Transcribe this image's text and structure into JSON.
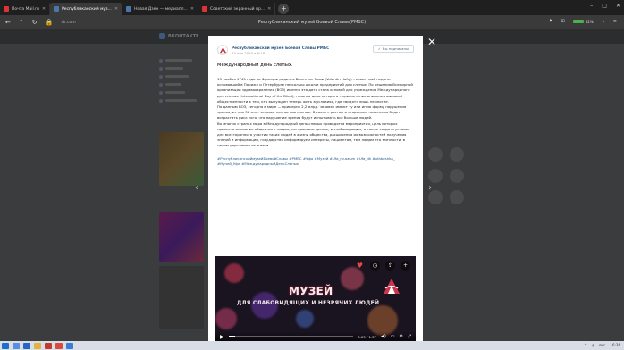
{
  "browser": {
    "tabs": [
      {
        "label": "Почта Mail.ru",
        "active": false
      },
      {
        "label": "Республиканский муз...",
        "active": true
      },
      {
        "label": "Новая Дзен — медиапл...",
        "active": false
      },
      {
        "label": "Советский экранный пр...",
        "active": false
      }
    ],
    "new_tab": "+",
    "window_title": "Республиканский музей Боевой Славы(РМБС)",
    "url": "vk.com",
    "battery": "52%",
    "controls": [
      "–",
      "□",
      "✕"
    ]
  },
  "vk": {
    "logo_text": "ВКОНТАКТЕ"
  },
  "post": {
    "group_name": "Республиканский музей Боевой Славы РМБС",
    "date": "13 ноя 2020 в 9:18",
    "subscribe_label": "Вы подписаны",
    "title": "Международный день слепых.",
    "paragraphs": [
      "13 ноября 1745 года во Франции родился Валентин Гаюи (Valentin Haüy) – известный педагог, основавший в Париже и Петербурге несколько школ и предприятий для слепых. По решению Всемирной организации здравоохранения (ВОЗ) именно эта дата стала основой для учреждения Международного дня слепых (International Day of the Blind), главная цель которого – привлечение внимания широкой общественности к тем, кто вынужден теперь жить в условиях, где «видят» лишь немногие.",
      "По данным ВОЗ, сегодня в мире — примерно 2,2 млрд. человек имеют ту или иную форму нарушения зрения, из них 36 млн. человек полностью слепые. В связи с ростом и старением населения будет возрастать риск того, что нарушение зрения будут испытывать всё больше людей.",
      "Во многих странах мира в Международный день слепых проводятся мероприятия, цель которых привлечь внимание общества к людям, потерявшим зрение, и слабовидящим, а также создать условия для всесторонного участия таких людей в жизни общества, расширения их возможностей получения знаний и информации, государство информируем интересы, пациентам, тем людям его занятости, в целом улучшения их жизни."
    ],
    "tags": "#РеспубликанскиймузейБоевойСлавы #РМБС #Уфа #Музей #Ufa_museum #Ufa_dk #ufabeshka_ #Музей_Уфа #МеждународныйДеньСлепых",
    "close_label": "✕",
    "prev_label": "‹",
    "next_label": "›"
  },
  "video": {
    "title": "МУЗЕЙ",
    "subtitle": "ДЛЯ СЛАБОВИДЯЩИХ И НЕЗРЯЧИХ ЛЮДЕЙ",
    "time": "0:05 / 1:37",
    "progress_fraction": 0.05,
    "icons": [
      "heart-icon",
      "clock-icon",
      "share-icon",
      "add-icon"
    ]
  },
  "taskbar": {
    "lang": "РУС",
    "time": "16:36"
  },
  "colors": {
    "accent": "#2a5885",
    "modal_bg": "#ffffff",
    "overlay": "#3b3c3d"
  }
}
